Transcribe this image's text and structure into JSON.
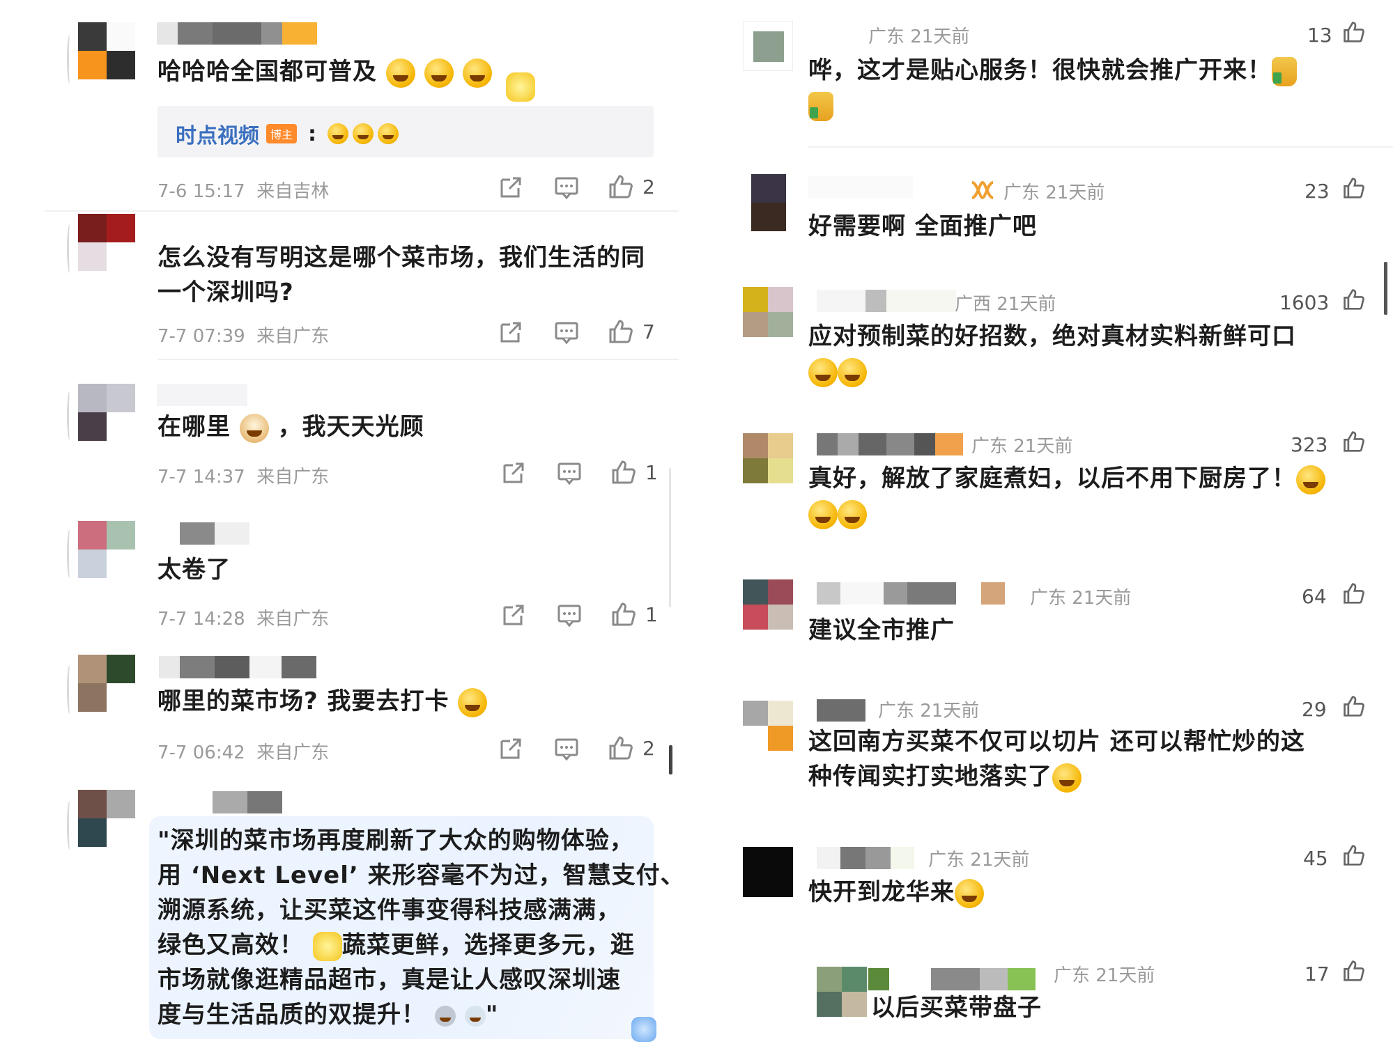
{
  "left": {
    "comments": [
      {
        "text": "哈哈哈全国都可普及",
        "time": "7-6 15:17",
        "from": "来自吉林",
        "likes": "2"
      },
      {
        "text": "怎么没有写明这是哪个菜市场，我们生活的同一个深圳吗?",
        "line1": "怎么没有写明这是哪个菜市场，我们生活的同",
        "line2": "一个深圳吗?",
        "time": "7-7 07:39",
        "from": "来自广东",
        "likes": "7"
      },
      {
        "text_a": "在哪里",
        "text_b": "，我天天光顾",
        "time": "7-7 14:37",
        "from": "来自广东",
        "likes": "1"
      },
      {
        "text": "太卷了",
        "time": "7-7 14:28",
        "from": "来自广东",
        "likes": "1"
      },
      {
        "text": "哪里的菜市场? 我要去打卡",
        "time": "7-7 06:42",
        "from": "来自广东",
        "likes": "2"
      },
      {
        "lines": [
          "\"深圳的菜市场再度刷新了大众的购物体验，",
          "用 ‘Next Level’ 来形容毫不为过，智慧支付、",
          "溯源系统，让买菜这件事变得科技感满满，",
          "蔬菜更鲜，选择更多元，逛",
          "市场就像逛精品超市，真是让人感叹深圳速",
          "度与生活品质的双提升！"
        ],
        "line4_prefix": "绿色又高效！",
        "closing_quote": "\""
      }
    ],
    "reply": {
      "name": "时点视频",
      "badge": "博主",
      "colon": ":"
    }
  },
  "right": {
    "comments": [
      {
        "loc": "广东 21天前",
        "likes": "13",
        "line1": "哗，这才是贴心服务！很快就会推广开来！"
      },
      {
        "loc": "广东 21天前",
        "likes": "23",
        "line1": "好需要啊 全面推广吧"
      },
      {
        "loc": "广西 21天前",
        "likes": "1603",
        "line1": "应对预制菜的好招数，绝对真材实料新鲜可口"
      },
      {
        "loc": "广东 21天前",
        "likes": "323",
        "line1": "真好，解放了家庭煮妇，以后不用下厨房了！"
      },
      {
        "loc": "广东 21天前",
        "likes": "64",
        "line1": "建议全市推广"
      },
      {
        "loc": "广东 21天前",
        "likes": "29",
        "line1": "这回南方买菜不仅可以切片 还可以帮忙炒的这",
        "line2": "种传闻实打实地落实了"
      },
      {
        "loc": "广东 21天前",
        "likes": "45",
        "line1": "快开到龙华来"
      },
      {
        "loc": "广东 21天前",
        "likes": "17",
        "line1": "以后买菜带盘子"
      }
    ]
  },
  "colors": {
    "accent_blue": "#3a6fbf",
    "badge_orange": "#ff8a2b",
    "vip_orange": "#f0a030"
  }
}
